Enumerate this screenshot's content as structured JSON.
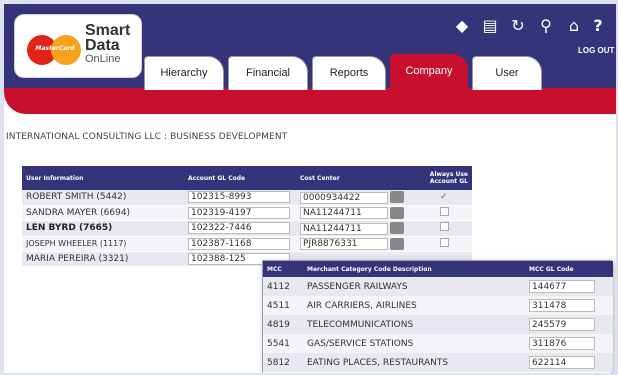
{
  "logo": {
    "mark_text": "MasterCard",
    "line1": "Smart",
    "line2": "Data",
    "line3": "OnLine"
  },
  "tabs": [
    {
      "label": "Hierarchy",
      "active": false
    },
    {
      "label": "Financial",
      "active": false
    },
    {
      "label": "Reports",
      "active": false
    },
    {
      "label": "Company",
      "active": true
    },
    {
      "label": "User",
      "active": false
    }
  ],
  "toolbar": {
    "icons": [
      "back-icon",
      "print-icon",
      "refresh-icon",
      "search-icon",
      "home-icon",
      "help-icon"
    ],
    "logout_label": "LOG OUT"
  },
  "breadcrumb": "INTERNATIONAL CONSULTING LLC : BUSINESS DEVELOPMENT",
  "user_table": {
    "headers": [
      "User Information",
      "Account GL Code",
      "Cost Center",
      "Always Use Account GL"
    ],
    "rows": [
      {
        "user": "ROBERT SMITH (5442)",
        "gl": "102315-8993",
        "cost": "0000934422",
        "always": true
      },
      {
        "user": "SANDRA MAYER (6694)",
        "gl": "102319-4197",
        "cost": "NA11244711",
        "always": false
      },
      {
        "user": "LEN BYRD (7665)",
        "gl": "102322-7446",
        "cost": "NA11244711",
        "always": false
      },
      {
        "user": "JOSEPH WHEELER (1117)",
        "gl": "102387-1168",
        "cost": "PJR8876331",
        "always": false
      },
      {
        "user": "MARIA PEREIRA (3321)",
        "gl": "102388-125",
        "cost": "",
        "always": false
      }
    ]
  },
  "mcc_popup": {
    "headers": [
      "MCC",
      "Merchant Category Code Description",
      "MCC GL Code"
    ],
    "rows": [
      {
        "mcc": "4112",
        "desc": "PASSENGER RAILWAYS",
        "gl": "144677"
      },
      {
        "mcc": "4511",
        "desc": "AIR CARRIERS, AIRLINES",
        "gl": "311478"
      },
      {
        "mcc": "4819",
        "desc": "TELECOMMUNICATIONS",
        "gl": "245579"
      },
      {
        "mcc": "5541",
        "desc": "GAS/SERVICE STATIONS",
        "gl": "311876"
      },
      {
        "mcc": "5812",
        "desc": "EATING PLACES, RESTAURANTS",
        "gl": "622114"
      }
    ]
  },
  "colors": {
    "header": "#35347a",
    "accent": "#c8102e"
  }
}
